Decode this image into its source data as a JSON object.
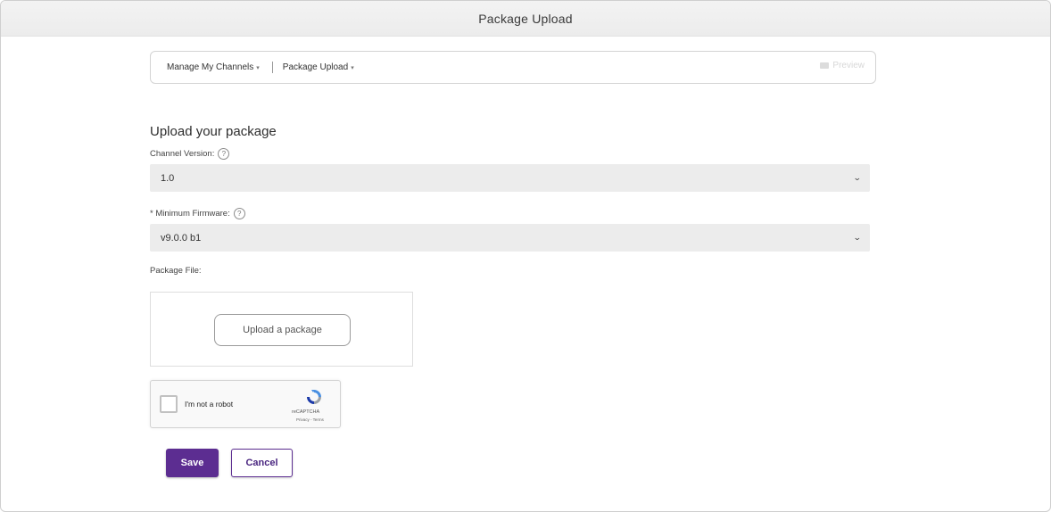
{
  "header": {
    "title": "Package Upload"
  },
  "breadcrumb": {
    "items": [
      {
        "label": "Manage My Channels"
      },
      {
        "label": "Package Upload"
      }
    ],
    "preview_label": "Preview"
  },
  "form": {
    "section_title": "Upload your package",
    "channel_version": {
      "label": "Channel Version:",
      "help": "?",
      "value": "1.0"
    },
    "minimum_firmware": {
      "label": "* Minimum Firmware:",
      "help": "?",
      "value": "v9.0.0 b1"
    },
    "package_file": {
      "label": "Package File:",
      "upload_button": "Upload a package"
    },
    "captcha": {
      "label": "I'm not a robot",
      "brand": "reCAPTCHA",
      "links": "Privacy - Terms"
    },
    "save_label": "Save",
    "cancel_label": "Cancel"
  },
  "colors": {
    "accent": "#5c2d91",
    "select_bg": "#ececec"
  }
}
